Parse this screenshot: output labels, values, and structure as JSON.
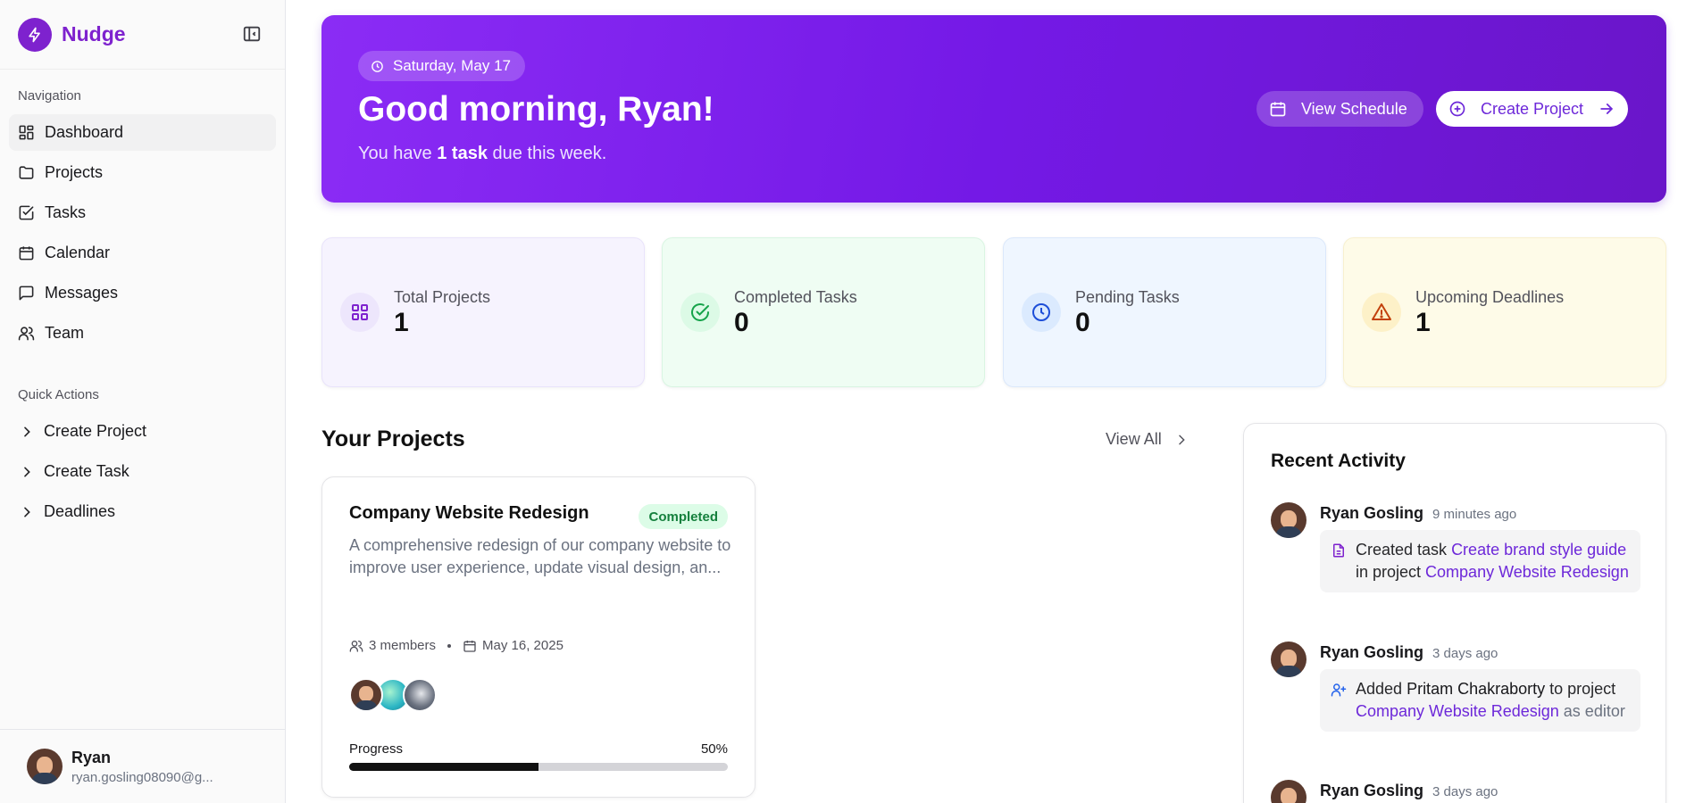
{
  "app": {
    "name": "Nudge"
  },
  "colors": {
    "brand": "#7e22ce",
    "hero_start": "#8b2cf5",
    "hero_end": "#6a16c9",
    "completed_badge": "#15803d"
  },
  "sidebar": {
    "nav_label": "Navigation",
    "nav_items": [
      {
        "label": "Dashboard",
        "icon": "dashboard-icon",
        "active": true
      },
      {
        "label": "Projects",
        "icon": "folder-icon"
      },
      {
        "label": "Tasks",
        "icon": "check-square-icon"
      },
      {
        "label": "Calendar",
        "icon": "calendar-icon"
      },
      {
        "label": "Messages",
        "icon": "message-icon"
      },
      {
        "label": "Team",
        "icon": "users-icon"
      }
    ],
    "quick_label": "Quick Actions",
    "quick_items": [
      {
        "label": "Create Project",
        "icon": "chevron-right-icon"
      },
      {
        "label": "Create Task",
        "icon": "chevron-right-icon"
      },
      {
        "label": "Deadlines",
        "icon": "chevron-right-icon"
      }
    ],
    "user": {
      "name": "Ryan",
      "email": "ryan.gosling08090@g..."
    }
  },
  "hero": {
    "date": "Saturday, May 17",
    "greeting": "Good morning, Ryan!",
    "sub_prefix": "You have ",
    "sub_bold": "1 task",
    "sub_suffix": " due this week.",
    "view_schedule": "View Schedule",
    "create_project": "Create Project"
  },
  "stats": [
    {
      "label": "Total Projects",
      "value": "1",
      "icon": "grid-icon"
    },
    {
      "label": "Completed Tasks",
      "value": "0",
      "icon": "check-circle-icon"
    },
    {
      "label": "Pending Tasks",
      "value": "0",
      "icon": "clock-icon"
    },
    {
      "label": "Upcoming Deadlines",
      "value": "1",
      "icon": "alert-triangle-icon"
    }
  ],
  "projects": {
    "title": "Your Projects",
    "view_all": "View All",
    "items": [
      {
        "title": "Company Website Redesign",
        "status": "Completed",
        "description": "A comprehensive redesign of our company website to improve user experience, update visual design, an...",
        "members": "3 members",
        "date": "May 16, 2025",
        "progress_label": "Progress",
        "progress_text": "50%",
        "progress": 0.5
      }
    ]
  },
  "activity": {
    "title": "Recent Activity",
    "items": [
      {
        "user": "Ryan Gosling",
        "time": "9 minutes ago",
        "icon": "file-icon",
        "t1": "Created task ",
        "link1": "Create brand style guide",
        "t2": " in project ",
        "link2": "Company Website Redesign"
      },
      {
        "user": "Ryan Gosling",
        "time": "3 days ago",
        "icon": "user-plus-icon",
        "t1": "Added ",
        "strong": "Pritam Chakraborty",
        "t2": " to project ",
        "link1": "Company Website Redesign",
        "t3": " as editor"
      },
      {
        "user": "Ryan Gosling",
        "time": "3 days ago"
      }
    ]
  }
}
